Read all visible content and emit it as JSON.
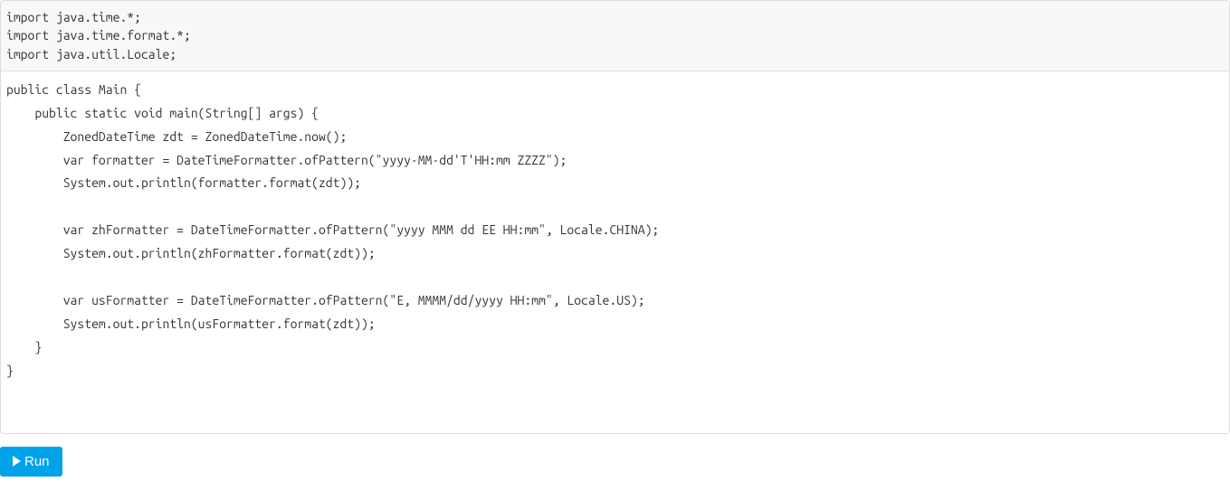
{
  "code": {
    "imports": "import java.time.*;\nimport java.time.format.*;\nimport java.util.Locale;",
    "body": "public class Main {\n    public static void main(String[] args) {\n        ZonedDateTime zdt = ZonedDateTime.now();\n        var formatter = DateTimeFormatter.ofPattern(\"yyyy-MM-dd'T'HH:mm ZZZZ\");\n        System.out.println(formatter.format(zdt));\n\n        var zhFormatter = DateTimeFormatter.ofPattern(\"yyyy MMM dd EE HH:mm\", Locale.CHINA);\n        System.out.println(zhFormatter.format(zdt));\n\n        var usFormatter = DateTimeFormatter.ofPattern(\"E, MMMM/dd/yyyy HH:mm\", Locale.US);\n        System.out.println(usFormatter.format(zdt));\n    }\n}"
  },
  "buttons": {
    "run_label": "Run"
  }
}
